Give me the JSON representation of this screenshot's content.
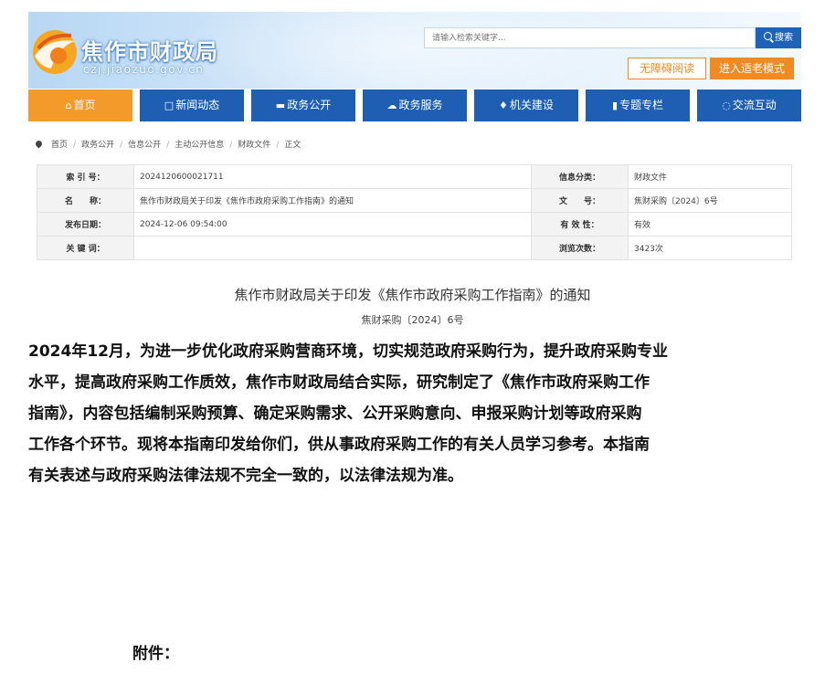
{
  "header": {
    "site_title": "焦作市财政局",
    "site_domain": "czj.jiaozuo.gov.cn",
    "search_placeholder": "请输入检索关键字...",
    "search_label": "搜索",
    "accessible_label": "无障碍阅读",
    "elder_mode_label": "进入适老模式"
  },
  "nav": {
    "items": [
      {
        "label": "首页",
        "icon": "home-icon"
      },
      {
        "label": "新闻动态",
        "icon": "document-icon"
      },
      {
        "label": "政务公开",
        "icon": "folder-icon"
      },
      {
        "label": "政务服务",
        "icon": "cloud-icon"
      },
      {
        "label": "机关建设",
        "icon": "trophy-icon"
      },
      {
        "label": "专题专栏",
        "icon": "bookmark-icon"
      },
      {
        "label": "交流互动",
        "icon": "chat-icon"
      }
    ]
  },
  "breadcrumb": [
    "首页",
    "政务公开",
    "信息公开",
    "主动公开信息",
    "财政文件",
    "正文"
  ],
  "info": {
    "index_label": "索 引 号：",
    "index_value": "2024120600021711",
    "category_label": "信息分类：",
    "category_value": "财政文件",
    "name_label": "名　　称：",
    "name_value": "焦作市财政局关于印发《焦作市政府采购工作指南》的通知",
    "docno_label": "文　　号：",
    "docno_value": "焦财采购〔2024〕6号",
    "date_label": "发布日期：",
    "date_value": "2024-12-06 09:54:00",
    "validity_label": "有 效 性：",
    "validity_value": "有效",
    "keywords_label": "关 键 词：",
    "keywords_value": "",
    "views_label": "浏览次数：",
    "views_value": "3423次"
  },
  "article": {
    "title": "焦作市财政局关于印发《焦作市政府采购工作指南》的通知",
    "doc_number": "焦财采购〔2024〕6号",
    "body_lines": [
      "2024年12月，为进一步优化政府采购营商环境，切实规范政府采购行为，提升政府采购专业",
      "水平，提高政府采购工作质效，焦作市财政局结合实际，研究制定了《焦作市政府采购工作",
      "指南》，内容包括编制采购预算、确定采购需求、公开采购意向、申报采购计划等政府采购",
      "工作各个环节。现将本指南印发给你们，供从事政府采购工作的有关人员学习参考。本指南",
      "有关表述与政府采购法律法规不完全一致的，以法律法规为准。"
    ],
    "attachment_label": "附件："
  },
  "colors": {
    "nav_blue": "#1e5fb3",
    "nav_active": "#f39a2a",
    "accent_orange": "#f08a24"
  }
}
